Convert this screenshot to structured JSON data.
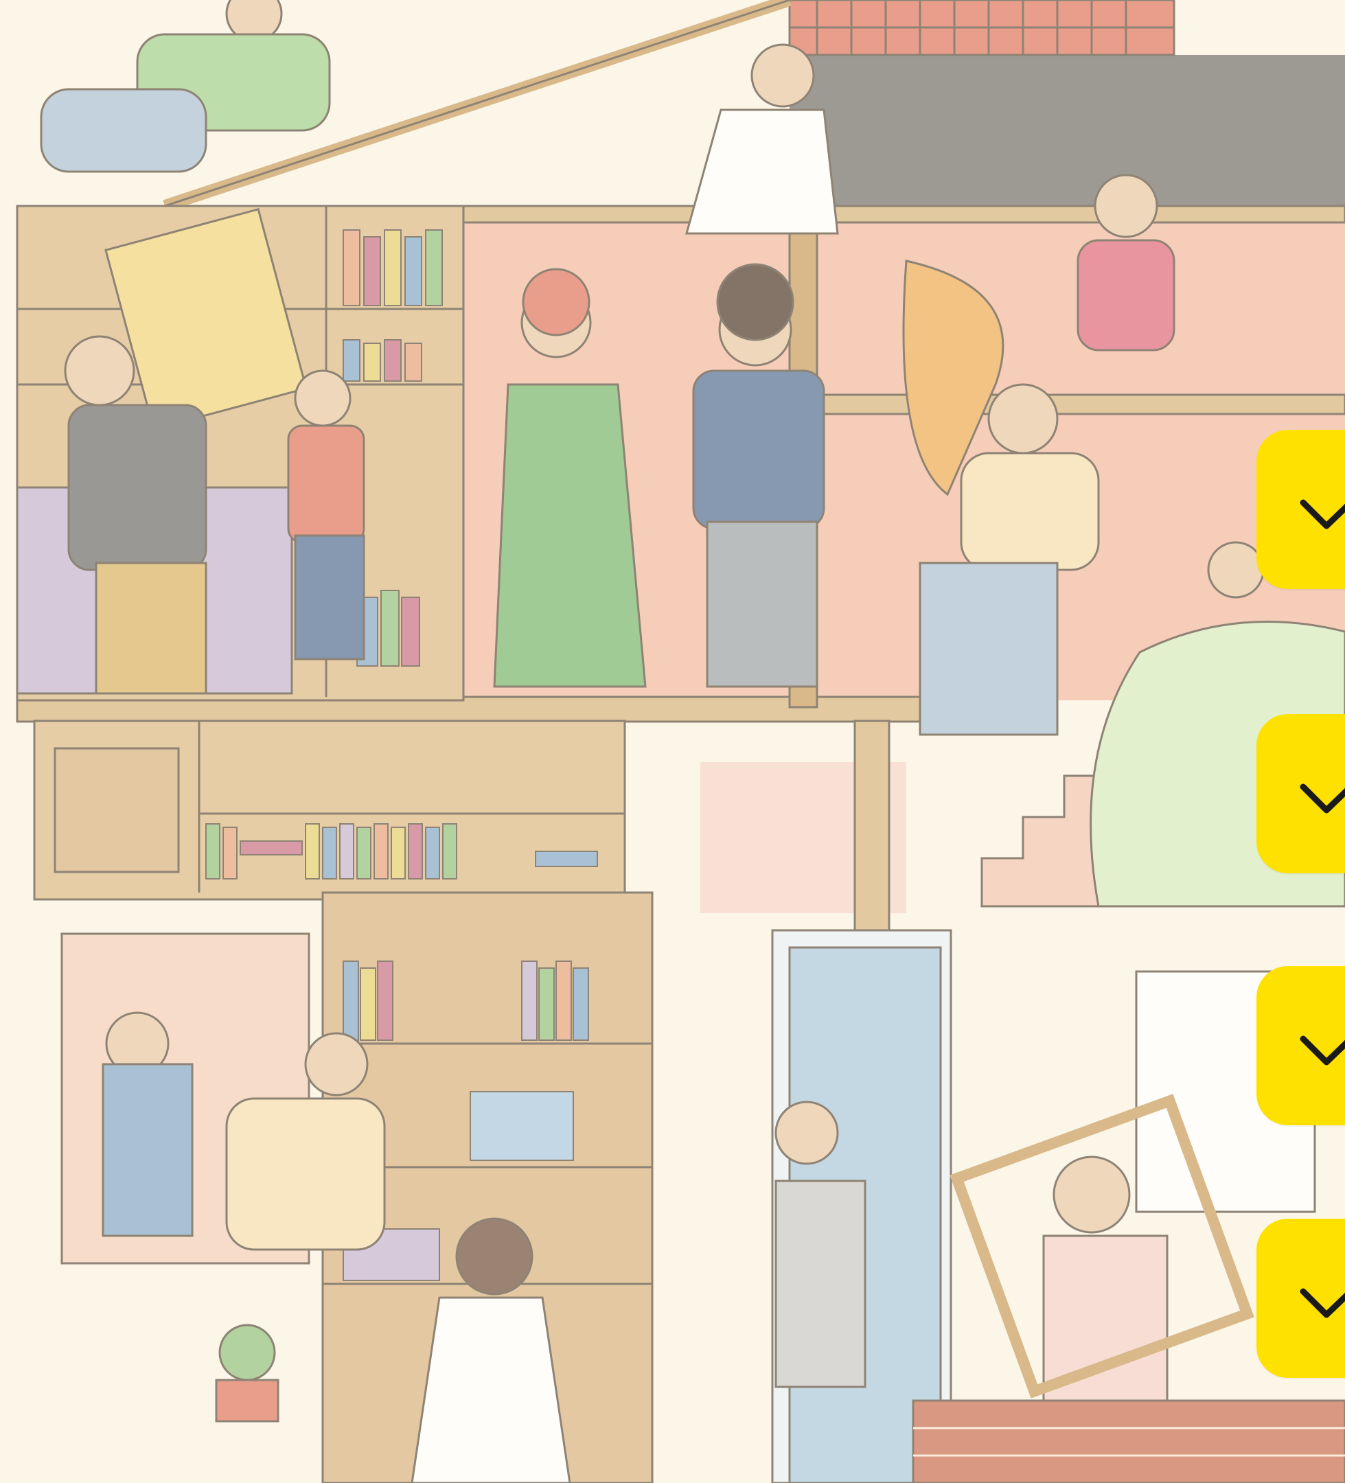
{
  "scene": {
    "kind": "seek-and-find illustration: people moving books and furniture in a multi-storey house"
  },
  "theme": {
    "accent": "#ffe100",
    "check_color": "#1a1a1a",
    "background": "#fbf4e6"
  },
  "check_buttons": [
    {
      "state": "checked",
      "icon": "checkmark-icon"
    },
    {
      "state": "checked",
      "icon": "checkmark-icon"
    },
    {
      "state": "checked",
      "icon": "checkmark-icon"
    },
    {
      "state": "checked",
      "icon": "checkmark-icon"
    }
  ]
}
